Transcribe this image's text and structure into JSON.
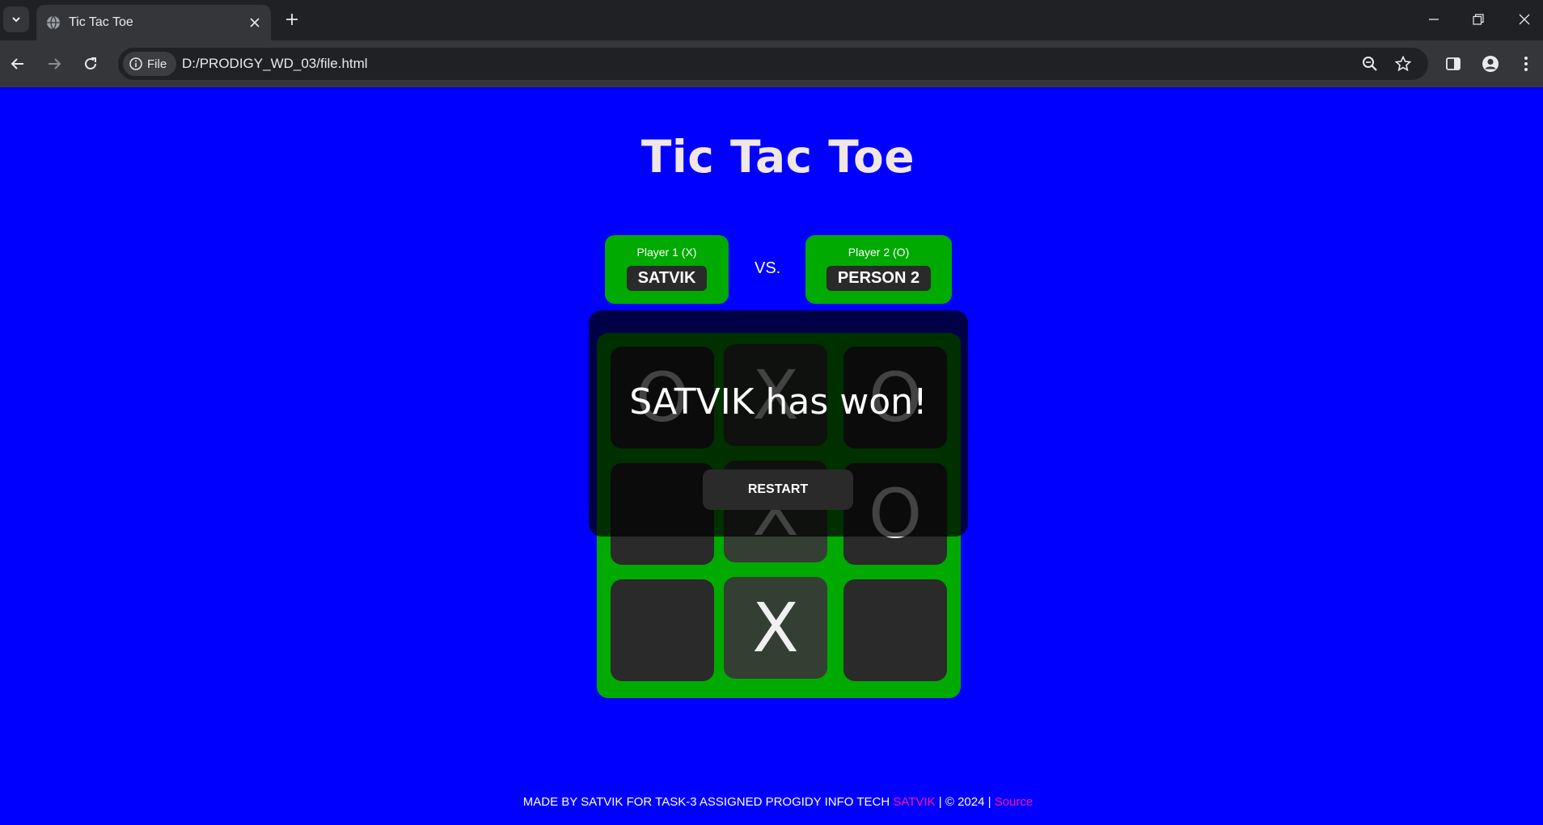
{
  "browser": {
    "tab_title": "Tic Tac Toe",
    "site_chip_label": "File",
    "url": "D:/PRODIGY_WD_03/file.html"
  },
  "page": {
    "title": "Tic Tac Toe",
    "vs_label": "VS.",
    "player1": {
      "label": "Player 1 (X)",
      "name": "SATVIK"
    },
    "player2": {
      "label": "Player 2 (O)",
      "name": "PERSON 2"
    },
    "board": [
      "O",
      "X",
      "O",
      "",
      "X",
      "O",
      "",
      "X",
      ""
    ],
    "winning_cells": [
      1,
      4,
      7
    ],
    "win_message": "SATVIK has won!",
    "restart_label": "RESTART",
    "colors": {
      "background": "#0000ff",
      "card": "#00aa00",
      "cell": "#2a2a2a",
      "link": "#ff1493"
    }
  },
  "footer": {
    "text": "MADE BY SATVIK FOR TASK-3 ASSIGNED PROGIDY INFO TECH",
    "author_link": "SATVIK",
    "copyright": "| © 2024 |",
    "source_link": "Source"
  }
}
